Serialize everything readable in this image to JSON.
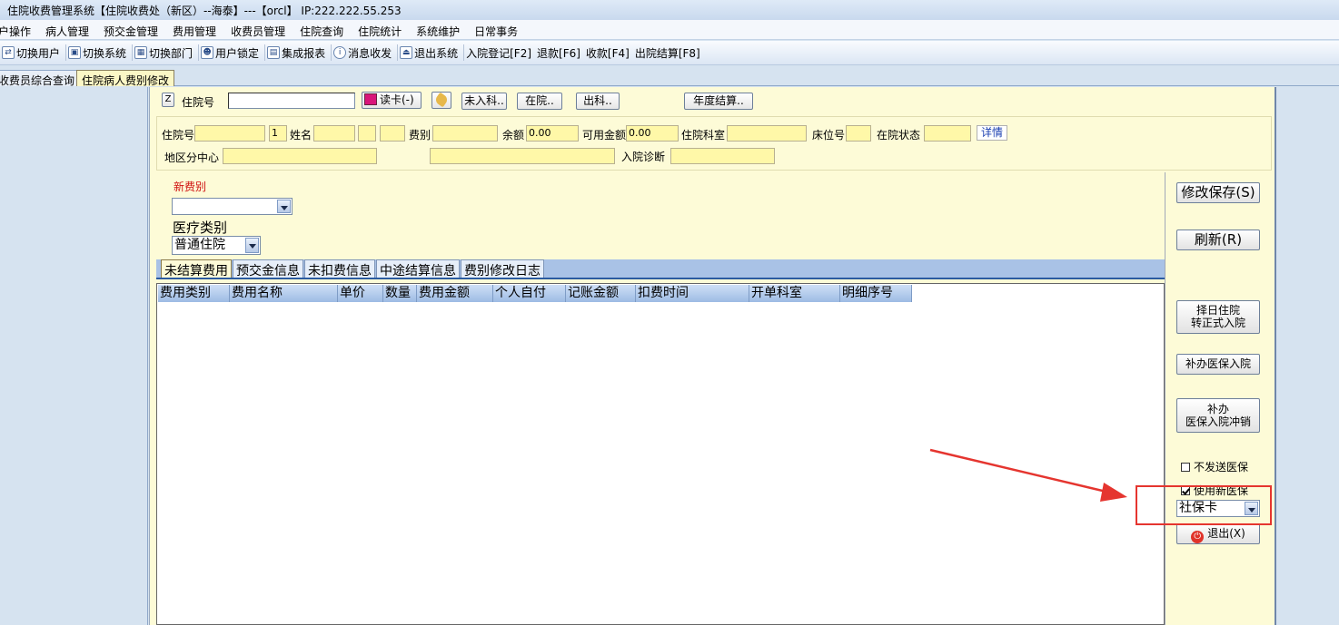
{
  "window": {
    "title": "住院收费管理系统【住院收费处（新区）--海泰】---【orcl】 IP:222.222.55.253"
  },
  "menu": [
    "用户操作",
    "病人管理",
    "预交金管理",
    "费用管理",
    "收费员管理",
    "住院查询",
    "住院统计",
    "系统维护",
    "日常事务"
  ],
  "menu_visible": [
    "户操作",
    "病人管理",
    "预交金管理",
    "费用管理",
    "收费员管理",
    "住院查询",
    "住院统计",
    "系统维护",
    "日常事务"
  ],
  "toolbar": [
    {
      "icon": "switch-user-icon",
      "label": "切换用户"
    },
    {
      "icon": "switch-system-icon",
      "label": "切换系统"
    },
    {
      "icon": "switch-dept-icon",
      "label": "切换部门"
    },
    {
      "icon": "user-lock-icon",
      "label": "用户锁定"
    },
    {
      "icon": "report-icon",
      "label": "集成报表"
    },
    {
      "icon": "message-icon",
      "label": "消息收发"
    },
    {
      "icon": "exit-icon",
      "label": "退出系统"
    },
    {
      "icon": "",
      "label": "入院登记[F2]"
    },
    {
      "icon": "",
      "label": "退款[F6]"
    },
    {
      "icon": "",
      "label": "收款[F4]"
    },
    {
      "icon": "",
      "label": "出院结算[F8]"
    }
  ],
  "tabs": [
    {
      "label": "收费员综合查询",
      "active": false
    },
    {
      "label": "住院病人费别修改",
      "active": true
    }
  ],
  "search": {
    "z_label": "Z",
    "label": "住院号",
    "value": "",
    "read_card": "读卡(-)",
    "not_admitted": "未入科..",
    "in_hospital": "在院..",
    "discharged": "出科..",
    "annual": "年度结算.."
  },
  "patient": {
    "inpatient_no_label": "住院号",
    "inpatient_no": "",
    "seq": "1",
    "name_label": "姓名",
    "name": "",
    "fee_type_label": "费别",
    "fee_type": "",
    "balance_label": "余额",
    "balance": "0.00",
    "available_label": "可用金额",
    "available": "0.00",
    "dept_label": "住院科室",
    "dept": "",
    "bed_label": "床位号",
    "bed": "",
    "status_label": "在院状态",
    "status": "",
    "detail": "详情",
    "region_label": "地区分中心",
    "region": "",
    "diag_label": "入院诊断",
    "diag": ""
  },
  "edit": {
    "new_fee_label": "新费别",
    "new_fee_value": "",
    "med_type_label": "医疗类别",
    "med_type_value": "普通住院"
  },
  "subtabs": [
    {
      "label": "未结算费用",
      "active": true
    },
    {
      "label": "预交金信息",
      "active": false
    },
    {
      "label": "未扣费信息",
      "active": false
    },
    {
      "label": "中途结算信息",
      "active": false
    },
    {
      "label": "费别修改日志",
      "active": false
    }
  ],
  "grid": {
    "columns": [
      "费用类别",
      "费用名称",
      "单价",
      "数量",
      "费用金额",
      "个人自付",
      "记账金额",
      "扣费时间",
      "开单科室",
      "明细序号"
    ],
    "rows": []
  },
  "side": {
    "save": "修改保存(S)",
    "refresh": "刷新(R)",
    "convert_line1": "择日住院",
    "convert_line2": "转正式入院",
    "supplement": "补办医保入院",
    "cancel_line1": "补办",
    "cancel_line2": "医保入院冲销",
    "no_send": "不发送医保",
    "use_new": "使用新医保",
    "card_type": "社保卡",
    "exit": "退出(X)"
  },
  "colors": {
    "highlight": "#e5352f",
    "field": "#fff8a8",
    "panel": "#fdfbd7"
  }
}
